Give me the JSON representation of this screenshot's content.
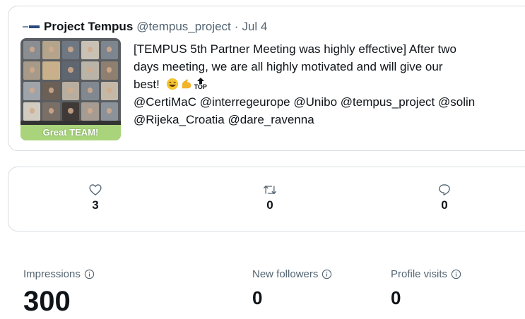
{
  "tweet": {
    "author_name": "Project Tempus",
    "author_handle": "@tempus_project",
    "separator": "·",
    "date": "Jul 4",
    "image_caption": "Great TEAM!",
    "text_line1": "[TEMPUS 5th Partner Meeting was highly effective] After two",
    "text_line2": "days meeting, we are all highly motivated and will give our",
    "text_line3": "best!",
    "emoji_names": [
      "grinning-face-icon",
      "flexed-biceps-icon",
      "top-arrow-icon"
    ],
    "top_badge_text": "TOP",
    "mentions_line1": [
      "@CertiMaC",
      "@interregeurope",
      "@Unibo",
      "@tempus_project",
      "@solin"
    ],
    "mentions_line2": [
      "@Rijeka_Croatia",
      "@dare_ravenna"
    ]
  },
  "engagement": {
    "likes": "3",
    "retweets": "0",
    "replies": "0",
    "icons": [
      "heart-icon",
      "retweet-icon",
      "reply-icon"
    ]
  },
  "stats": {
    "impressions_label": "Impressions",
    "impressions_value": "300",
    "new_followers_label": "New followers",
    "new_followers_value": "0",
    "profile_visits_label": "Profile visits",
    "profile_visits_value": "0"
  },
  "colors": {
    "text": "#0f1419",
    "muted": "#536471",
    "border": "#d6dde2",
    "caption_bg": "#a9d47c"
  }
}
